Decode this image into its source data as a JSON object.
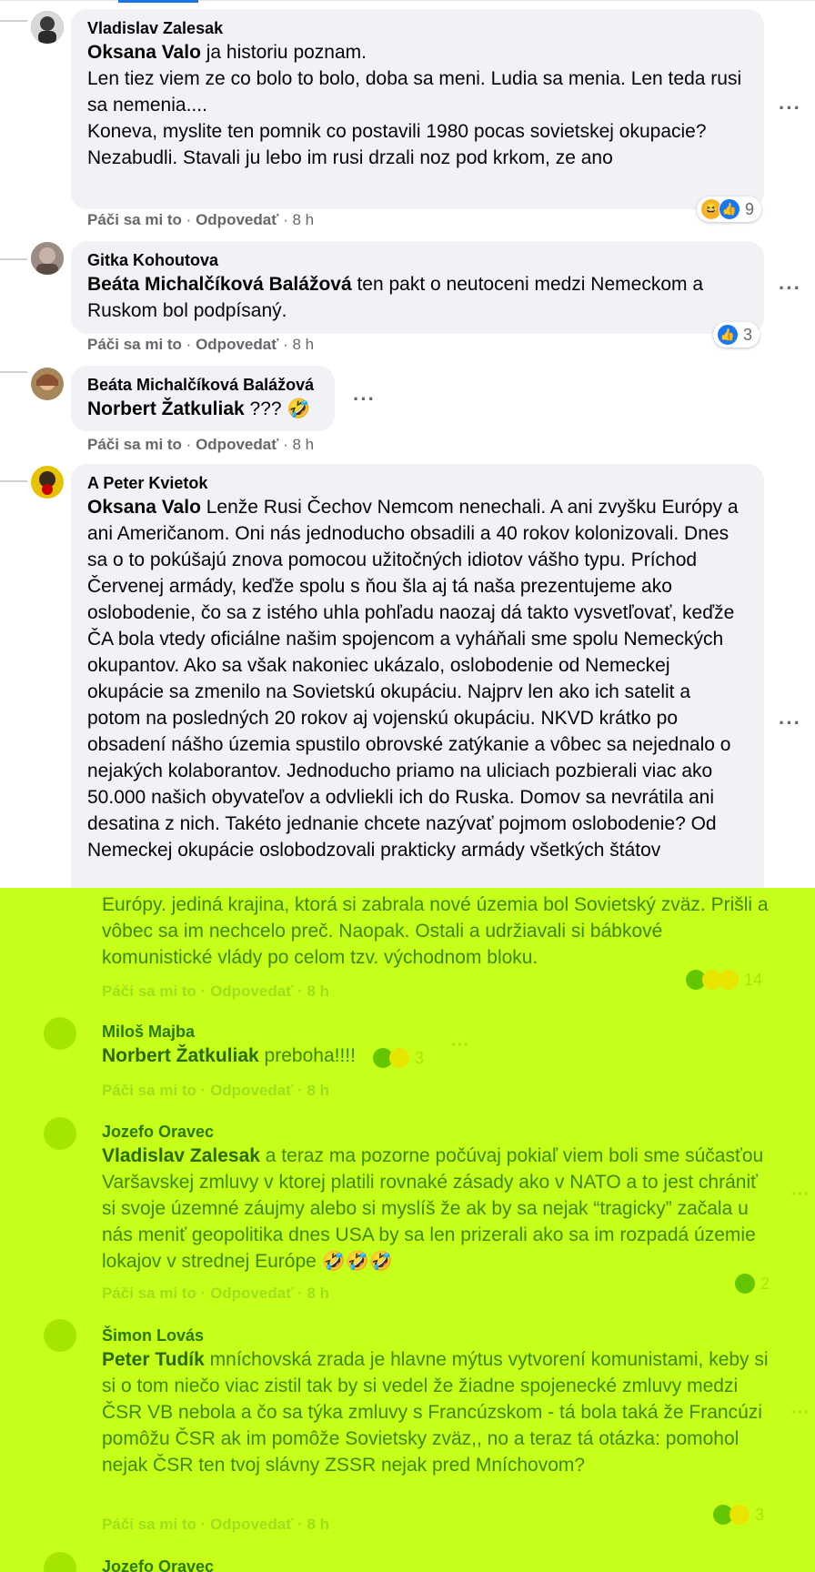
{
  "comments": [
    {
      "author": "Vladislav Zalesak",
      "mention": "Oksana Valo",
      "text": " ja historiu poznam.\nLen tiez viem ze co bolo to bolo, doba sa meni. Ludia sa menia. Len teda rusi sa nemenia....\nKoneva, myslite ten pomnik co postavili 1980 pocas sovietskej okupacie?\nNezabudli. Stavali ju lebo im rusi drzali noz pod krkom, ze ano",
      "like": "Páči sa mi to",
      "reply": "Odpovedať",
      "time": "8 h",
      "reaction_count": "9"
    },
    {
      "author": "Gitka Kohoutova",
      "mention": "Beáta Michalčíková Balážová",
      "text": " ten pakt o neutoceni medzi Nemeckom a Ruskom bol podpísaný.",
      "like": "Páči sa mi to",
      "reply": "Odpovedať",
      "time": "8 h",
      "reaction_count": "3"
    },
    {
      "author": "Beáta Michalčíková Balážová",
      "mention": "Norbert Žatkuliak",
      "text": " ??? 🤣",
      "like": "Páči sa mi to",
      "reply": "Odpovedať",
      "time": "8 h"
    },
    {
      "author": "A Peter Kvietok",
      "mention": "Oksana Valo",
      "text": " Lenže Rusi Čechov Nemcom nenechali. A ani zvyšku Európy a ani Američanom. Oni nás jednoducho obsadili a 40 rokov kolonizovali. Dnes sa o to pokúšajú znova pomocou užitočných idiotov vášho typu. Príchod Červenej armády, keďže spolu s ňou šla aj tá naša prezentujeme ako oslobodenie, čo sa z istého uhla pohľadu naozaj dá takto vysvetľovať, keďže ČA bola vtedy oficiálne našim spojencom a vyháňali sme spolu Nemeckých okupantov. Ako sa však nakoniec ukázalo, oslobodenie od Nemeckej okupácie sa zmenilo na Sovietskú okupáciu. Najprv len ako ich satelit a potom na posledných 20 rokov aj vojenskú okupáciu. NKVD krátko po obsadení nášho územia spustilo obrovské zatýkanie a vôbec sa nejednalo o nejakých kolaborantov. Jednoducho priamo na uliciach pozbierali viac ako 50.000 našich obyvateľov a odvliekli ich do Ruska. Domov sa nevrátila ani desatina z nich. Takéto jednanie chcete nazývať pojmom oslobodenie? Od Nemeckej okupácie oslobodzovali prakticky armády všetkých štátov"
    }
  ],
  "overlay_comments": [
    {
      "text": "Európy. jediná krajina, ktorá si zabrala nové územia bol Sovietský zväz. Prišli a vôbec sa im nechcelo preč. Naopak. Ostali a udržiavali si bábkové komunistické vlády po celom tzv. východnom bloku.",
      "like": "Páči sa mi to",
      "reply": "Odpovedať",
      "time": "8 h",
      "reaction_count": "14"
    },
    {
      "author": "Miloš Majba",
      "mention": "Norbert Žatkuliak",
      "text": " preboha!!!!",
      "like": "Páči sa mi to",
      "reply": "Odpovedať",
      "time": "8 h",
      "reaction_count": "3"
    },
    {
      "author": "Jozefo Oravec",
      "mention": "Vladislav Zalesak",
      "text": " a teraz ma pozorne počúvaj pokiaľ viem boli sme súčasťou Varšavskej zmluvy v ktorej platili rovnaké zásady ako v NATO a to jest chrániť si svoje územné záujmy alebo si myslíš že ak by sa nejak “tragicky” začala u nás meniť geopolitika dnes USA by sa len prizerali ako sa im rozpadá územie lokajov v strednej Európe 🤣🤣🤣",
      "like": "Páči sa mi to",
      "reply": "Odpovedať",
      "time": "8 h",
      "reaction_count": "2"
    },
    {
      "author": "Šimon Lovás",
      "mention": "Peter Tudík",
      "text": " mníchovská zrada je hlavne mýtus vytvorení komunistami, keby si si o tom niečo viac zistil tak by si vedel že žiadne spojenecké zmluvy medzi ČSR VB nebola a čo sa týka zmluvy s Francúzskom - tá bola taká že Francúzi pomôžu ČSR ak im pomôže Sovietsky zväz,, no a teraz tá otázka: pomohol nejak ČSR ten tvoj slávny ZSSR nejak pred Mníchovom?",
      "like": "Páči sa mi to",
      "reply": "Odpovedať",
      "time": "8 h",
      "reaction_count": "3"
    },
    {
      "author": "Jozefo Oravec"
    }
  ],
  "separator": "·",
  "more_label": "···"
}
